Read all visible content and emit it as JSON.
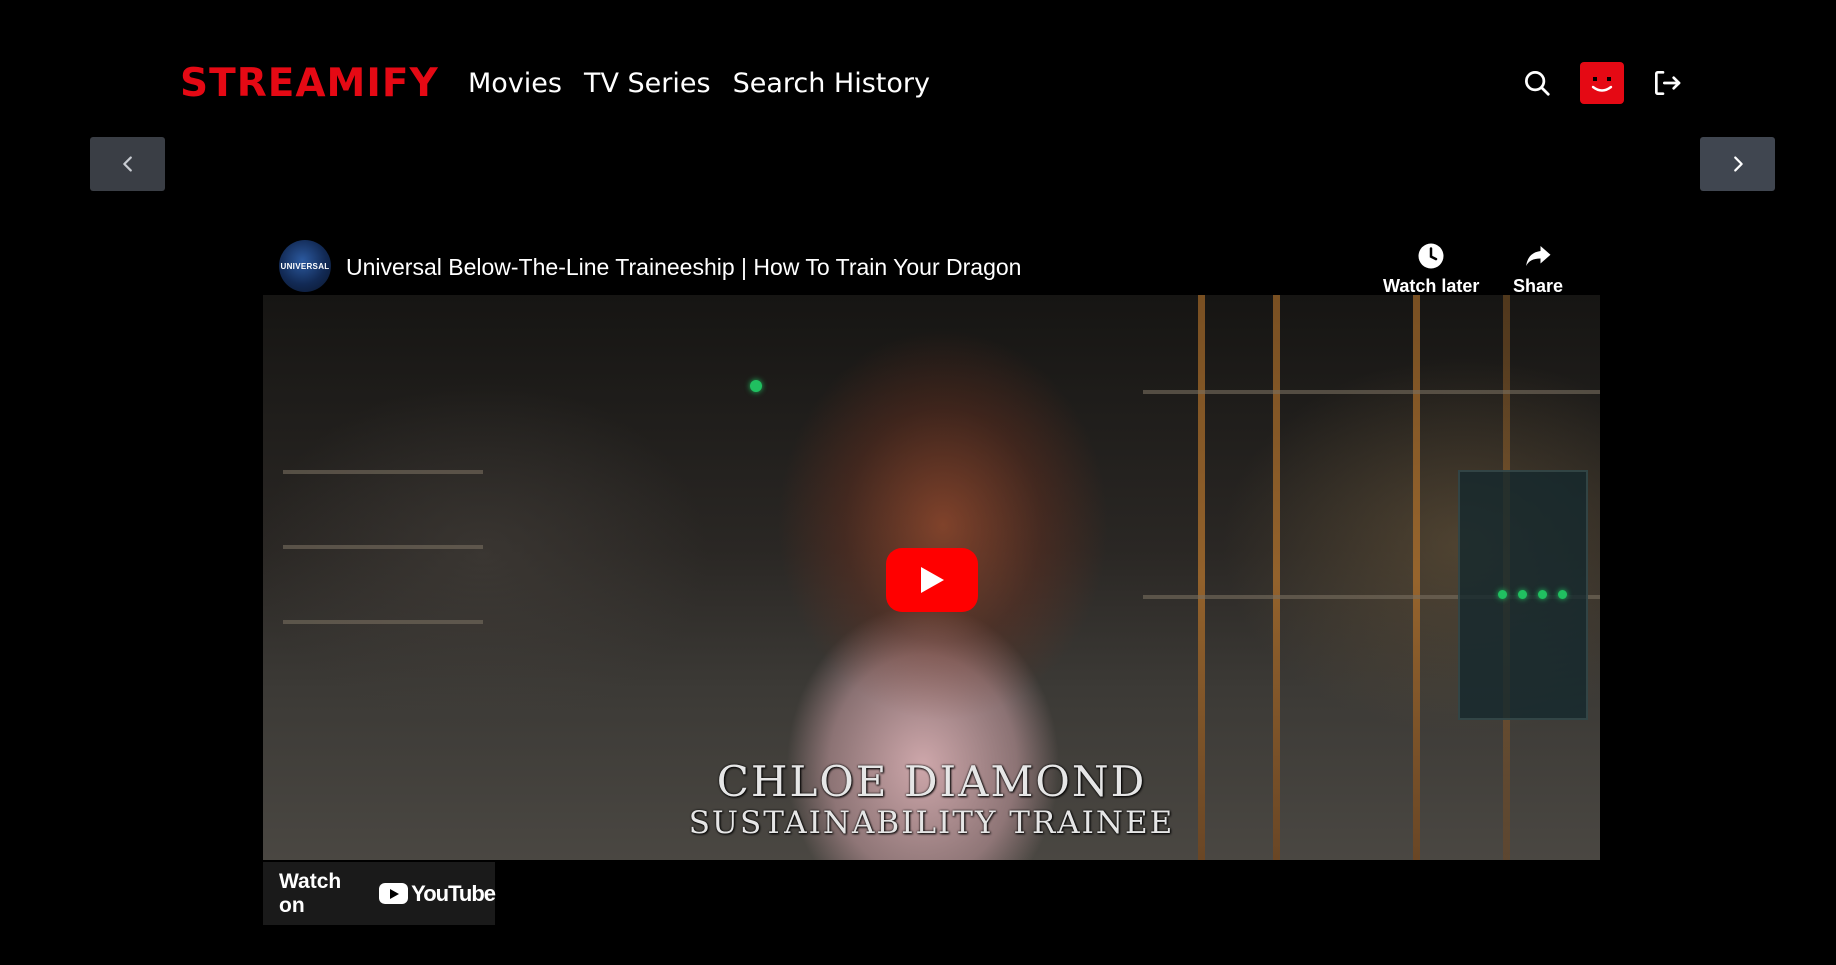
{
  "brand": {
    "name": "STREAMIFY",
    "color": "#e50914"
  },
  "nav": {
    "items": [
      "Movies",
      "TV Series",
      "Search History"
    ]
  },
  "header_icons": [
    "search-icon",
    "avatar-icon",
    "logout-icon"
  ],
  "carousel": {
    "prev_icon": "chevron-left-icon",
    "next_icon": "chevron-right-icon"
  },
  "video": {
    "channel_logo_text": "UNIVERSAL",
    "title": "Universal Below-The-Line Traineeship | How To Train Your Dragon",
    "actions": {
      "watch_later": "Watch later",
      "share": "Share"
    },
    "overlay": {
      "name": "CHLOE DIAMOND",
      "role": "SUSTAINABILITY TRAINEE"
    },
    "watch_on": {
      "label": "Watch on",
      "brand": "YouTube"
    },
    "play_color": "#ff0000"
  }
}
